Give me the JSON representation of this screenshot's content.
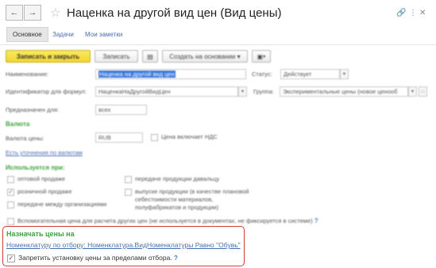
{
  "window": {
    "title": "Наценка на другой вид цен (Вид цены)"
  },
  "tabs": [
    {
      "label": "Основное"
    },
    {
      "label": "Задачи"
    },
    {
      "label": "Мои заметки"
    }
  ],
  "toolbar": {
    "save_close": "Записать и закрыть",
    "save": "Записать",
    "create_based": "Создать на основании"
  },
  "form": {
    "name_label": "Наименование:",
    "name_value": "Наценка на другой вид цен",
    "status_label": "Статус:",
    "status_value": "Действует",
    "formula_id_label": "Идентификатор для формул:",
    "formula_id_value": "НаценкаНаДругойВидЦен",
    "group_label": "Группа:",
    "group_value": "Экспериментальные цены (новое ценооб",
    "purpose_label": "Предназначен для:",
    "purpose_value": "всех",
    "currency_section": "Валюта",
    "currency_label": "Валюта цены:",
    "currency_value": "RUB",
    "vat_label": "Цена включает НДС",
    "rounding_link": "Есть уточнения по валютам",
    "used_section": "Используется при:",
    "checks": [
      {
        "label": "оптовой продаже",
        "checked": false
      },
      {
        "label": "передаче продукции давальцу",
        "checked": false
      },
      {
        "label": "розничной продаже",
        "checked": true
      },
      {
        "label": "выпуске продукции (в качестве плановой себестоимости материалов, полуфабрикатов и продукции)",
        "checked": false
      },
      {
        "label": "передаче между организациями",
        "checked": false
      }
    ],
    "aux_check": "Вспомогательная цена для расчета других цен (не используется в документах, не фиксируется в системе)",
    "assign_section": "Назначать цены на",
    "assign_link": "Номенклатуру по отбору: Номенклатура.ВидНоменклатуры Равно \"Обувь\"",
    "forbid_label": "Запретить установку цены за пределами отбора.",
    "help_q": "?"
  }
}
